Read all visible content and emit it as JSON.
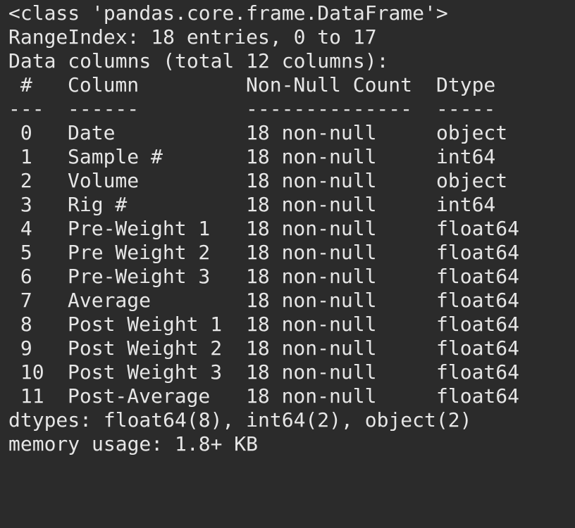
{
  "output": {
    "class_line": "<class 'pandas.core.frame.DataFrame'>",
    "range_index": "RangeIndex: 18 entries, 0 to 17",
    "data_columns": "Data columns (total 12 columns):",
    "header": {
      "idx": " #",
      "column": "Column",
      "count": "Non-Null Count",
      "dtype": "Dtype"
    },
    "separator": {
      "idx": "---",
      "column": "------",
      "count": "--------------",
      "dtype": "-----"
    },
    "rows": [
      {
        "idx": " 0",
        "column": "Date",
        "count": "18 non-null",
        "dtype": "object"
      },
      {
        "idx": " 1",
        "column": "Sample #",
        "count": "18 non-null",
        "dtype": "int64"
      },
      {
        "idx": " 2",
        "column": "Volume",
        "count": "18 non-null",
        "dtype": "object"
      },
      {
        "idx": " 3",
        "column": "Rig #",
        "count": "18 non-null",
        "dtype": "int64"
      },
      {
        "idx": " 4",
        "column": "Pre-Weight 1",
        "count": "18 non-null",
        "dtype": "float64"
      },
      {
        "idx": " 5",
        "column": "Pre Weight 2",
        "count": "18 non-null",
        "dtype": "float64"
      },
      {
        "idx": " 6",
        "column": "Pre-Weight 3",
        "count": "18 non-null",
        "dtype": "float64"
      },
      {
        "idx": " 7",
        "column": "Average",
        "count": "18 non-null",
        "dtype": "float64"
      },
      {
        "idx": " 8",
        "column": "Post Weight 1",
        "count": "18 non-null",
        "dtype": "float64"
      },
      {
        "idx": " 9",
        "column": "Post Weight 2",
        "count": "18 non-null",
        "dtype": "float64"
      },
      {
        "idx": " 10",
        "column": "Post Weight 3",
        "count": "18 non-null",
        "dtype": "float64"
      },
      {
        "idx": " 11",
        "column": "Post-Average",
        "count": "18 non-null",
        "dtype": "float64"
      }
    ],
    "dtypes_line": "dtypes: float64(8), int64(2), object(2)",
    "memory_line": "memory usage: 1.8+ KB"
  },
  "colors": {
    "background": "#2b2b2b",
    "text": "#e6e6e6"
  }
}
